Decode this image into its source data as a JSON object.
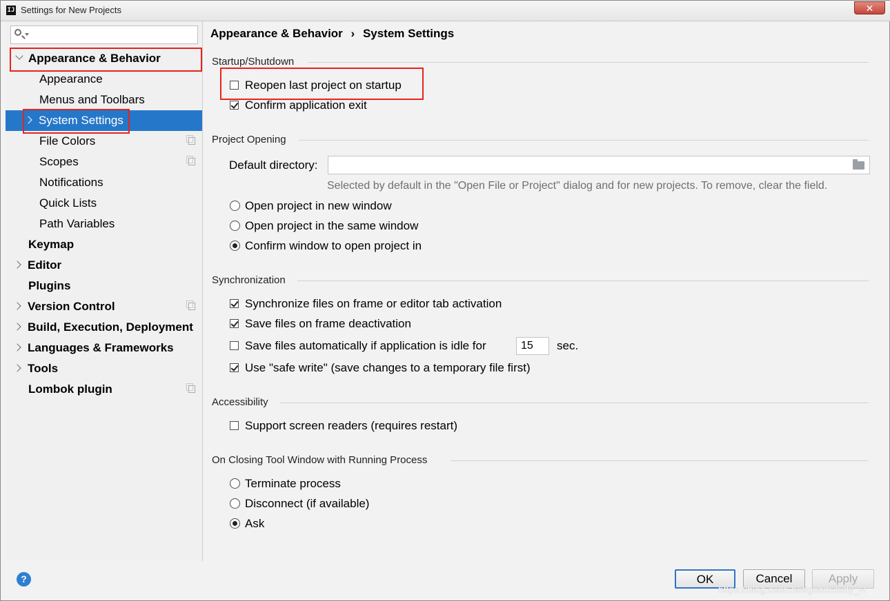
{
  "window": {
    "title": "Settings for New Projects",
    "app_icon": "IJ",
    "close_label": "✕"
  },
  "search": {
    "placeholder": "",
    "value": ""
  },
  "sidebar": {
    "items": [
      {
        "label": "Appearance & Behavior",
        "bold": true,
        "expander": "down"
      },
      {
        "label": "Appearance",
        "bold": false
      },
      {
        "label": "Menus and Toolbars",
        "bold": false
      },
      {
        "label": "System Settings",
        "bold": false,
        "expander": "right",
        "selected": true
      },
      {
        "label": "File Colors",
        "bold": false,
        "copy_icon": true
      },
      {
        "label": "Scopes",
        "bold": false,
        "copy_icon": true
      },
      {
        "label": "Notifications",
        "bold": false
      },
      {
        "label": "Quick Lists",
        "bold": false
      },
      {
        "label": "Path Variables",
        "bold": false
      },
      {
        "label": "Keymap",
        "bold": true
      },
      {
        "label": "Editor",
        "bold": true,
        "expander": "right"
      },
      {
        "label": "Plugins",
        "bold": true
      },
      {
        "label": "Version Control",
        "bold": true,
        "expander": "right",
        "copy_icon": true
      },
      {
        "label": "Build, Execution, Deployment",
        "bold": true,
        "expander": "right"
      },
      {
        "label": "Languages & Frameworks",
        "bold": true,
        "expander": "right"
      },
      {
        "label": "Tools",
        "bold": true,
        "expander": "right"
      },
      {
        "label": "Lombok plugin",
        "bold": true,
        "copy_icon": true
      }
    ]
  },
  "breadcrumb": {
    "parent": "Appearance & Behavior",
    "separator": "›",
    "current": "System Settings"
  },
  "startup": {
    "title": "Startup/Shutdown",
    "reopen_last_project": {
      "label": "Reopen last project on startup",
      "checked": false
    },
    "confirm_exit": {
      "label": "Confirm application exit",
      "checked": true
    }
  },
  "project_opening": {
    "title": "Project Opening",
    "default_directory_label": "Default directory:",
    "default_directory_value": "",
    "hint": "Selected by default in the \"Open File or Project\" dialog and for new projects. To remove, clear the field.",
    "options": [
      {
        "label": "Open project in new window",
        "selected": false
      },
      {
        "label": "Open project in the same window",
        "selected": false
      },
      {
        "label": "Confirm window to open project in",
        "selected": true
      }
    ]
  },
  "synchronization": {
    "title": "Synchronization",
    "sync_on_activation": {
      "label": "Synchronize files on frame or editor tab activation",
      "checked": true
    },
    "save_on_deactivation": {
      "label": "Save files on frame deactivation",
      "checked": true
    },
    "save_when_idle": {
      "label": "Save files automatically if application is idle for",
      "checked": false,
      "value": "15",
      "unit": "sec."
    },
    "safe_write": {
      "label": "Use \"safe write\" (save changes to a temporary file first)",
      "checked": true
    }
  },
  "accessibility": {
    "title": "Accessibility",
    "screen_readers": {
      "label": "Support screen readers (requires restart)",
      "checked": false
    }
  },
  "closing_tool_window": {
    "title": "On Closing Tool Window with Running Process",
    "options": [
      {
        "label": "Terminate process",
        "selected": false
      },
      {
        "label": "Disconnect (if available)",
        "selected": false
      },
      {
        "label": "Ask",
        "selected": true
      }
    ]
  },
  "footer": {
    "help_label": "?",
    "ok_label": "OK",
    "cancel_label": "Cancel",
    "apply_label": "Apply",
    "apply_enabled": false
  },
  "watermark": "https://blog.csdn.net/goodStudy_H"
}
